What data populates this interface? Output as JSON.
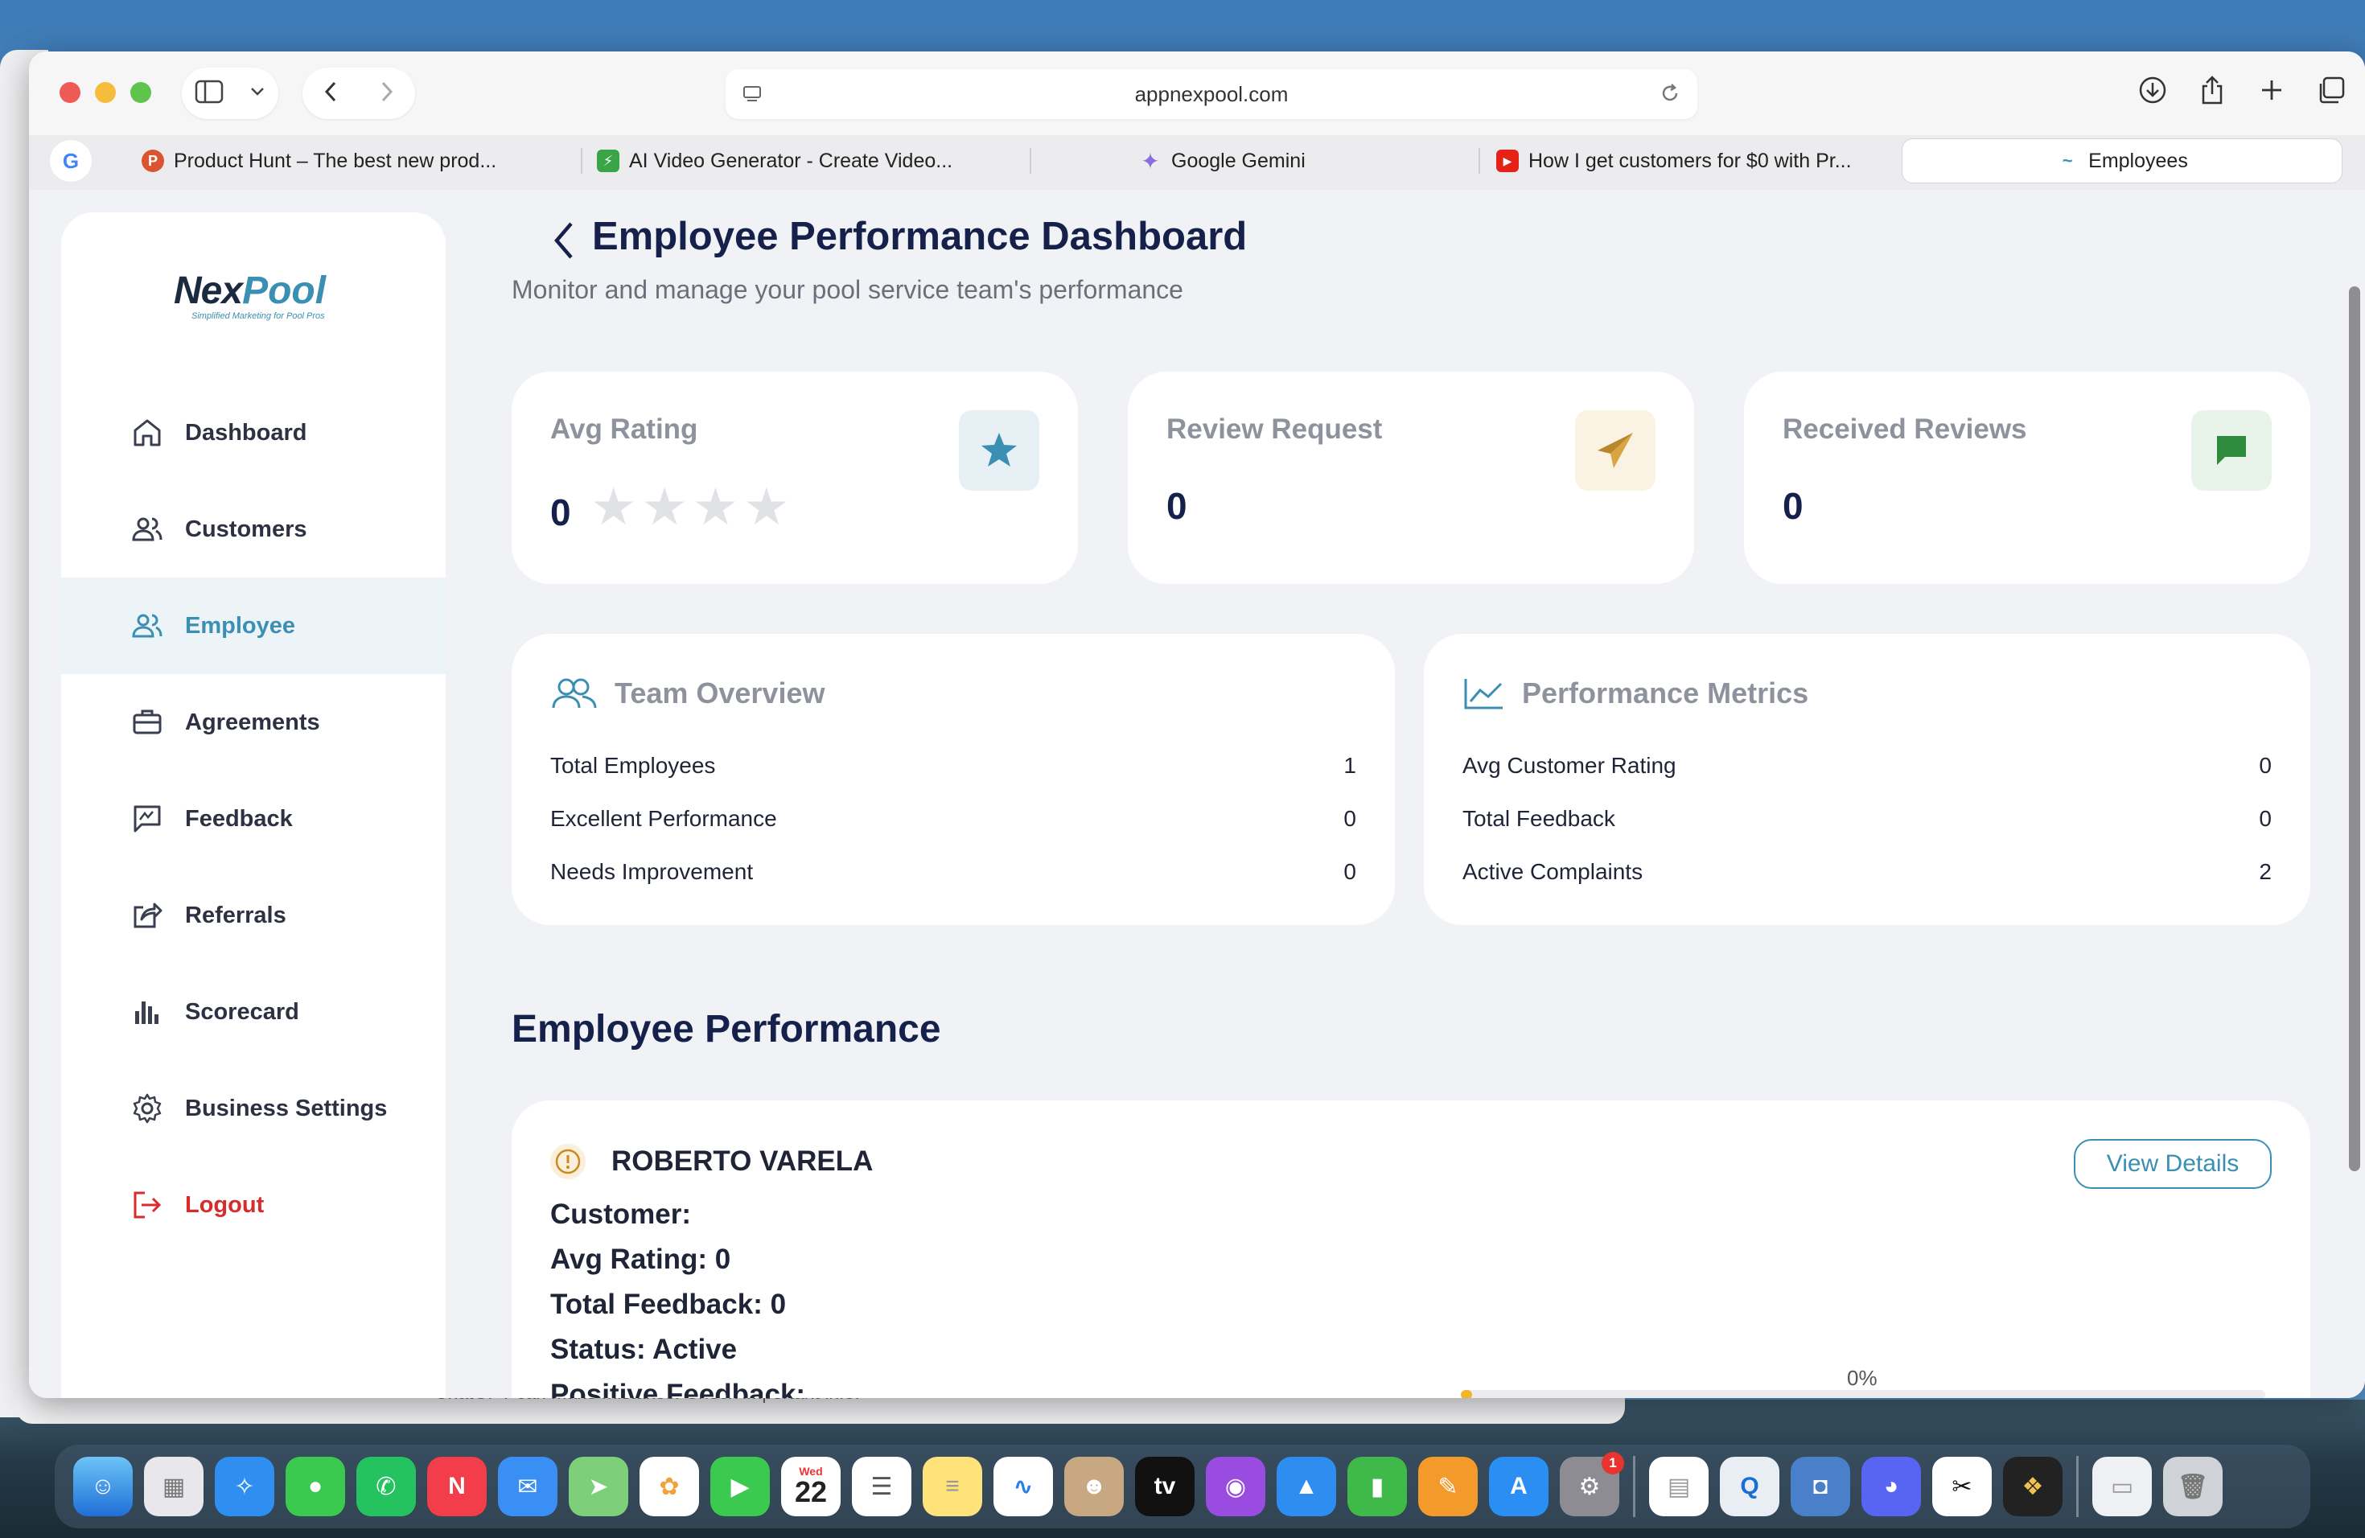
{
  "browser": {
    "url": "appnexpool.com",
    "tabs": [
      {
        "label": "Product Hunt – The best new prod...",
        "icon": "product-hunt-icon",
        "color": "#da552f",
        "glyph": "P"
      },
      {
        "label": "AI Video Generator - Create Video...",
        "icon": "ai-video-icon",
        "color": "#3aa547",
        "glyph": "⚡"
      },
      {
        "label": "Google Gemini",
        "icon": "gemini-icon",
        "color": "#8a6ee0",
        "glyph": "✦"
      },
      {
        "label": "How I get customers for $0 with Pr...",
        "icon": "youtube-icon",
        "color": "#e62117",
        "glyph": "▶"
      },
      {
        "label": "Employees",
        "icon": "nexpool-favicon",
        "color": "#3b8fb3",
        "glyph": "~"
      }
    ]
  },
  "brand": {
    "name_a": "Nex",
    "name_b": "Pool",
    "tagline": "Simplified Marketing for Pool Pros"
  },
  "sidebar": {
    "items": [
      {
        "label": "Dashboard",
        "icon": "home-icon"
      },
      {
        "label": "Customers",
        "icon": "users-icon"
      },
      {
        "label": "Employee",
        "icon": "users-icon"
      },
      {
        "label": "Agreements",
        "icon": "briefcase-icon"
      },
      {
        "label": "Feedback",
        "icon": "message-icon"
      },
      {
        "label": "Referrals",
        "icon": "share-icon"
      },
      {
        "label": "Scorecard",
        "icon": "bar-chart-icon"
      },
      {
        "label": "Business Settings",
        "icon": "gear-icon"
      },
      {
        "label": "Logout",
        "icon": "logout-icon"
      }
    ],
    "active": "Employee"
  },
  "page": {
    "title": "Employee Performance Dashboard",
    "subtitle": "Monitor and manage your pool service team's performance"
  },
  "stats": [
    {
      "label": "Avg Rating",
      "value": "0",
      "icon": "star-icon",
      "rating_stars": 0
    },
    {
      "label": "Review Request",
      "value": "0",
      "icon": "paper-plane-icon"
    },
    {
      "label": "Received Reviews",
      "value": "0",
      "icon": "chat-icon"
    }
  ],
  "team_overview": {
    "title": "Team Overview",
    "rows": [
      {
        "label": "Total Employees",
        "value": "1"
      },
      {
        "label": "Excellent Performance",
        "value": "0"
      },
      {
        "label": "Needs Improvement",
        "value": "0"
      }
    ]
  },
  "performance_metrics": {
    "title": "Performance Metrics",
    "rows": [
      {
        "label": "Avg Customer Rating",
        "value": "0"
      },
      {
        "label": "Total Feedback",
        "value": "0"
      },
      {
        "label": "Active Complaints",
        "value": "2"
      }
    ]
  },
  "employee_section": {
    "title": "Employee Performance",
    "employee": {
      "name": "ROBERTO VARELA",
      "button": "View Details",
      "customer": "Customer:",
      "avg_rating": "Avg Rating: 0",
      "total_feedback": "Total Feedback: 0",
      "status": "Status: Active",
      "positive_feedback": "Positive Feedback:",
      "progress_label": "0%",
      "progress": 0
    }
  },
  "background": {
    "chatgpt_note": "ChatGPT can make mistakes. Check important info."
  },
  "dock": {
    "calendar_month": "Wed",
    "calendar_day": "22",
    "settings_badge": "1",
    "apps": [
      "Finder",
      "Launchpad",
      "Safari",
      "Messages",
      "WhatsApp",
      "News",
      "Mail",
      "Maps",
      "Photos",
      "FaceTime",
      "Calendar",
      "Reminders",
      "Notes",
      "Freeform",
      "Contacts",
      "TV",
      "Podcasts",
      "Keynote",
      "Numbers",
      "Pages",
      "App Store",
      "System Settings",
      "TextEdit",
      "QuickTime",
      "Screen Sharing",
      "Discord",
      "CapCut",
      "Figma",
      "Preview",
      "Trash"
    ]
  }
}
